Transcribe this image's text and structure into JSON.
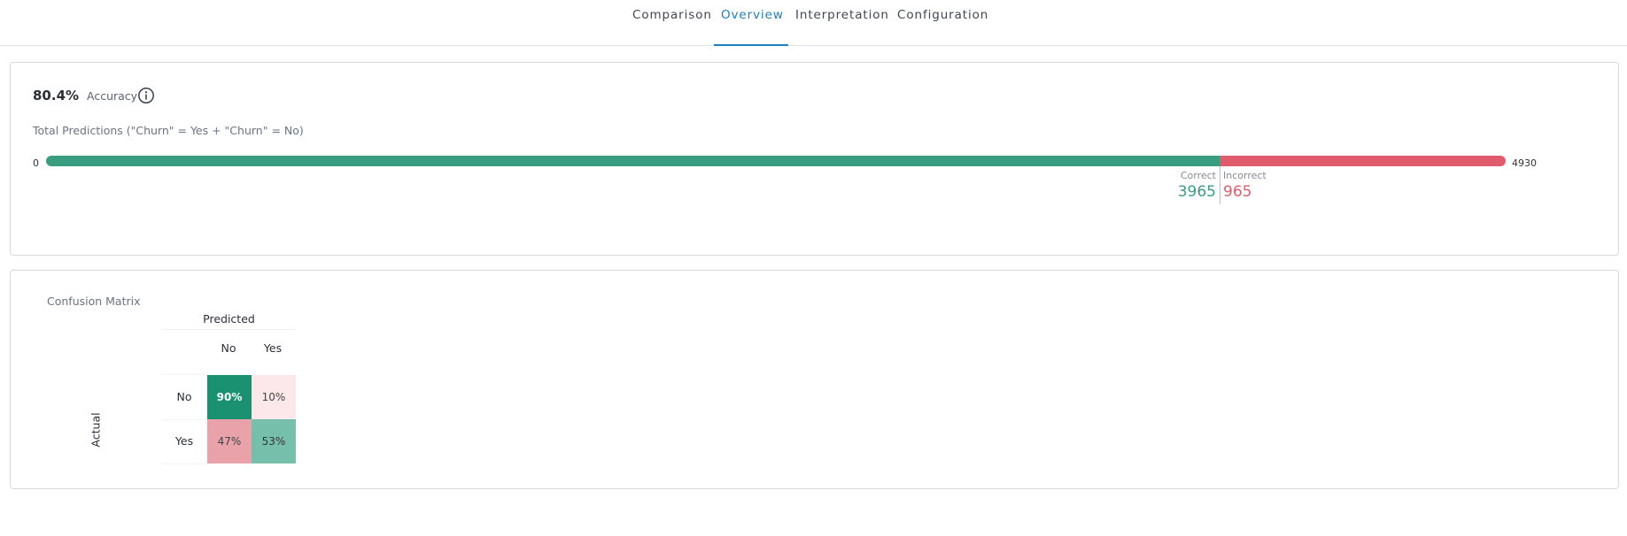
{
  "tabs": [
    {
      "label": "Comparison",
      "active": false
    },
    {
      "label": "Overview",
      "active": true
    },
    {
      "label": "Interpretation",
      "active": false
    },
    {
      "label": "Configuration",
      "active": false
    }
  ],
  "accuracy": {
    "value": "80.4%",
    "label": "Accuracy",
    "total_label": "Total Predictions (\"Churn\" = Yes + \"Churn\" = No)",
    "axis_min": "0",
    "axis_max": "4930",
    "correct_label": "Correct",
    "correct_value": "3965",
    "incorrect_label": "Incorrect",
    "incorrect_value": "965",
    "correct_count": 3965,
    "total_count": 4930,
    "colors": {
      "correct": "#389e7f",
      "incorrect": "#e05c6c"
    }
  },
  "confusion_matrix": {
    "title": "Confusion Matrix",
    "predicted_label": "Predicted",
    "actual_label": "Actual",
    "columns": [
      "No",
      "Yes"
    ],
    "rows": [
      "No",
      "Yes"
    ],
    "cells": [
      [
        {
          "text": "90%",
          "bg": "#1a9170",
          "color": "#ffffff",
          "bold": true
        },
        {
          "text": "10%",
          "bg": "#fce8ea",
          "color": "#444444",
          "bold": false
        }
      ],
      [
        {
          "text": "47%",
          "bg": "#eaa2aa",
          "color": "#444444",
          "bold": false
        },
        {
          "text": "53%",
          "bg": "#76bfab",
          "color": "#333333",
          "bold": false
        }
      ]
    ]
  }
}
